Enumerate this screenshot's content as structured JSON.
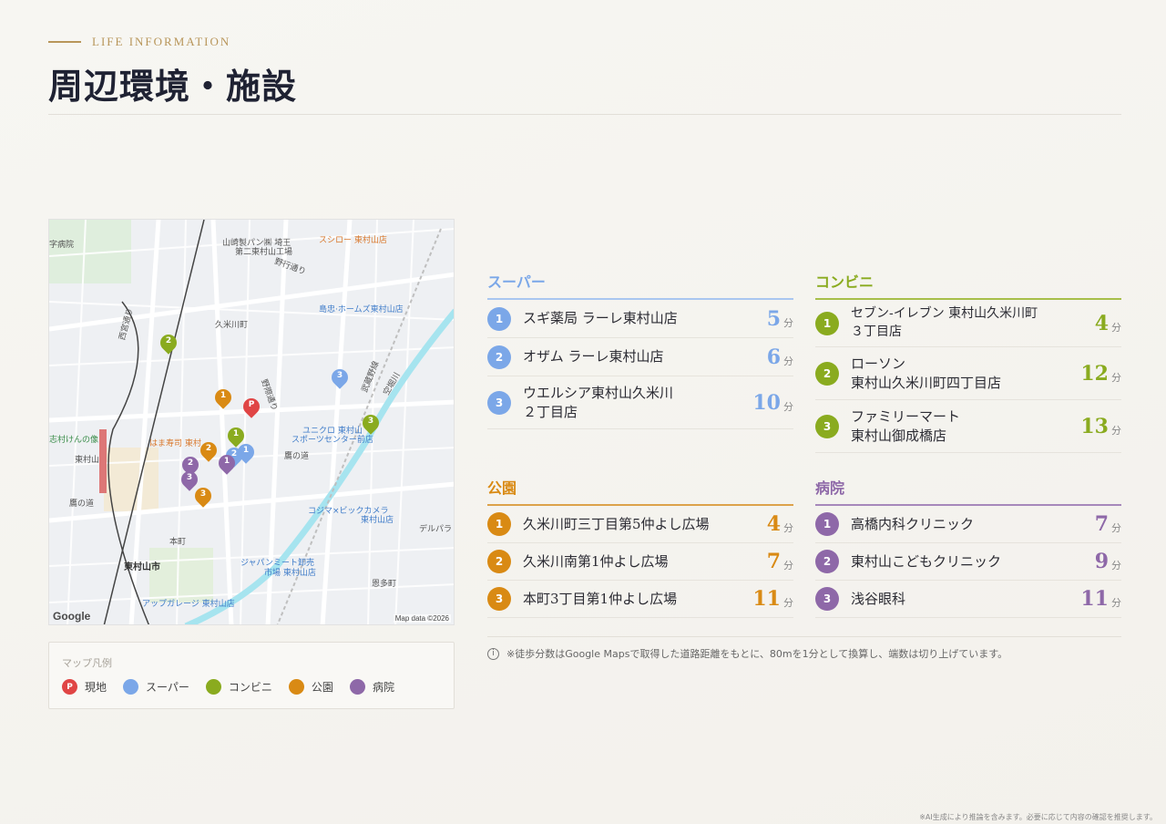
{
  "header": {
    "eyebrow": "LIFE INFORMATION",
    "title": "周辺環境・施設"
  },
  "colors": {
    "super": "#7ba7e8",
    "convenience": "#8aab1f",
    "park": "#d98a14",
    "hospital": "#8e68a8",
    "current": "#e04545",
    "gold": "#b8965a"
  },
  "map": {
    "google": "Google",
    "map_data": "Map data ©2026",
    "labels": [
      {
        "text": "山崎製パン㈱ 埼王",
        "class": ""
      },
      {
        "text": "第二東村山工場",
        "class": ""
      },
      {
        "text": "スシロー 東村山店",
        "class": "orange"
      },
      {
        "text": "野行通り",
        "class": ""
      },
      {
        "text": "島忠·ホームズ東村山店",
        "class": "blue"
      },
      {
        "text": "久米川町",
        "class": ""
      },
      {
        "text": "西宮通り",
        "class": ""
      },
      {
        "text": "はま寿司 東村",
        "class": "orange"
      },
      {
        "text": "ユニクロ 東村山",
        "class": "blue"
      },
      {
        "text": "スポーツセンター前店",
        "class": "blue"
      },
      {
        "text": "東村山",
        "class": "bold"
      },
      {
        "text": "鷹の道",
        "class": ""
      },
      {
        "text": "コジマ×ビックカメラ",
        "class": "blue"
      },
      {
        "text": "東村山店",
        "class": "blue"
      },
      {
        "text": "デルパラ",
        "class": ""
      },
      {
        "text": "本町",
        "class": ""
      },
      {
        "text": "東村山市",
        "class": "bold"
      },
      {
        "text": "ジャパンミート卸売",
        "class": "blue"
      },
      {
        "text": "市場 東村山店",
        "class": "blue"
      },
      {
        "text": "恩多町",
        "class": ""
      },
      {
        "text": "アップガレージ 東村山店",
        "class": "blue"
      },
      {
        "text": "志村けんの像",
        "class": "green"
      },
      {
        "text": "字病院",
        "class": ""
      },
      {
        "text": "武蔵野線",
        "class": ""
      },
      {
        "text": "鷹の道",
        "class": ""
      },
      {
        "text": "野際通り",
        "class": ""
      },
      {
        "text": "空堀川",
        "class": ""
      }
    ]
  },
  "legend": {
    "title": "マップ凡例",
    "items": [
      {
        "label": "現地",
        "mark": "P"
      },
      {
        "label": "スーパー",
        "mark": ""
      },
      {
        "label": "コンビニ",
        "mark": ""
      },
      {
        "label": "公園",
        "mark": ""
      },
      {
        "label": "病院",
        "mark": ""
      }
    ]
  },
  "unit": "分",
  "categories": {
    "super": {
      "title": "スーパー",
      "rows": [
        {
          "n": "1",
          "name": "スギ薬局 ラーレ東村山店",
          "min": "5"
        },
        {
          "n": "2",
          "name": "オザム ラーレ東村山店",
          "min": "6"
        },
        {
          "n": "3",
          "name": "ウエルシア東村山久米川\n２丁目店",
          "min": "10"
        }
      ]
    },
    "convenience": {
      "title": "コンビニ",
      "rows": [
        {
          "n": "1",
          "name": "セブン-イレブン 東村山久米川町\n３丁目店",
          "min": "4"
        },
        {
          "n": "2",
          "name": "ローソン\n東村山久米川町四丁目店",
          "min": "12"
        },
        {
          "n": "3",
          "name": "ファミリーマート\n東村山御成橋店",
          "min": "13"
        }
      ]
    },
    "park": {
      "title": "公園",
      "rows": [
        {
          "n": "1",
          "name": "久米川町三丁目第5仲よし広場",
          "min": "4"
        },
        {
          "n": "2",
          "name": "久米川南第1仲よし広場",
          "min": "7"
        },
        {
          "n": "3",
          "name": "本町3丁目第1仲よし広場",
          "min": "11"
        }
      ]
    },
    "hospital": {
      "title": "病院",
      "rows": [
        {
          "n": "1",
          "name": "高橋内科クリニック",
          "min": "7"
        },
        {
          "n": "2",
          "name": "東村山こどもクリニック",
          "min": "9"
        },
        {
          "n": "3",
          "name": "浅谷眼科",
          "min": "11"
        }
      ]
    }
  },
  "note": "※徒歩分数はGoogle Mapsで取得した道路距離をもとに、80mを1分として換算し、端数は切り上げています。",
  "footer": "※AI生成により推論を含みます。必要に応じて内容の確認を推奨します。"
}
